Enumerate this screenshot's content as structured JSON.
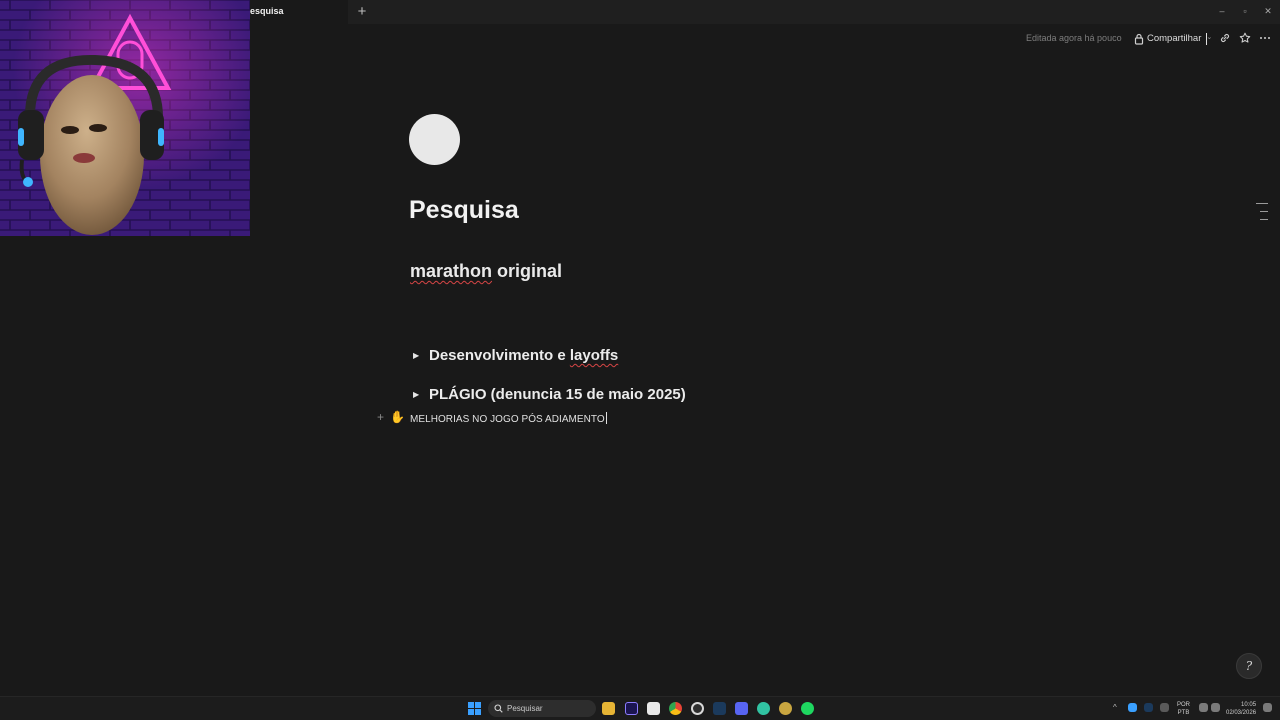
{
  "window": {
    "tab_title": "esquisa",
    "new_tab_symbol": "+",
    "controls": {
      "minimize": "–",
      "maximize": "▫",
      "close": "✕"
    }
  },
  "header": {
    "edited_text": "Editada agora há pouco",
    "share_label": "Compartilhar",
    "icons": [
      "lock-icon",
      "link-icon",
      "star-icon",
      "more-icon"
    ]
  },
  "page": {
    "icon": "white-circle-icon",
    "title": "Pesquisa",
    "heading_misspelled": "marathon",
    "heading_rest": " original",
    "toggles": [
      {
        "label_plain": "Desenvolvimento e ",
        "label_misspelled": "layoffs"
      },
      {
        "label_plain": "PLÁGIO (denuncia 15 de maio 2025)",
        "label_misspelled": ""
      }
    ],
    "current_line": "MELHORIAS NO JOGO PÓS ADIAMENTO",
    "block_add_symbol": "+",
    "block_drag_symbol": "✋"
  },
  "help_symbol": "?",
  "taskbar": {
    "search_placeholder": "Pesquisar",
    "lang_line1": "POR",
    "lang_line2": "PTB",
    "time": "10:05",
    "date": "02/03/2026",
    "tray_chevron": "^",
    "apps": [
      "start-icon",
      "file-explorer-icon",
      "premiere-icon",
      "notion-icon",
      "chrome-icon",
      "obs-icon",
      "steam-icon",
      "discord-icon",
      "streamlabs-icon",
      "app-icon",
      "spotify-icon"
    ]
  }
}
